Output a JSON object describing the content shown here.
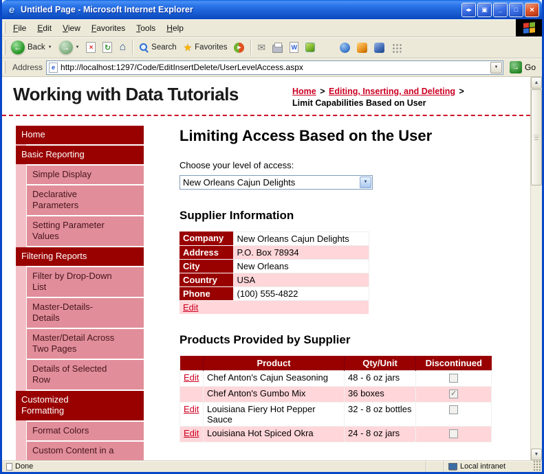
{
  "window": {
    "title": "Untitled Page - Microsoft Internet Explorer",
    "buttons": [
      {
        "name": "screen-toggle",
        "glyph": "◂▸"
      },
      {
        "name": "screen",
        "glyph": "▣"
      },
      {
        "name": "minimize",
        "glyph": "_"
      },
      {
        "name": "maximize",
        "glyph": "□"
      },
      {
        "name": "close",
        "glyph": "×"
      }
    ]
  },
  "menu": {
    "items": [
      "File",
      "Edit",
      "View",
      "Favorites",
      "Tools",
      "Help"
    ]
  },
  "toolbar": {
    "back_label": "Back",
    "search_label": "Search",
    "favorites_label": "Favorites"
  },
  "address": {
    "label": "Address",
    "url": "http://localhost:1297/Code/EditInsertDelete/UserLevelAccess.aspx",
    "go_label": "Go"
  },
  "status": {
    "left": "Done",
    "right": "Local intranet"
  },
  "icons": {
    "back_arrow": "←",
    "forward_arrow": "→",
    "stop": "×",
    "refresh": "↻",
    "home": "⌂",
    "star": "★",
    "media_play": "▶",
    "mail": "✉",
    "word_w": "W",
    "dropdown": "▼",
    "scroll_up": "▲",
    "scroll_down": "▼",
    "go_arrow": "→",
    "ie_e": "e"
  },
  "page": {
    "site_title": "Working with Data Tutorials",
    "breadcrumb": {
      "separator": ">",
      "links": [
        "Home",
        "Editing, Inserting, and Deleting"
      ],
      "current": "Limit Capabilities Based on User"
    },
    "sidebar": [
      {
        "label": "Home",
        "level": 0
      },
      {
        "label": "Basic Reporting",
        "level": 0
      },
      {
        "label": "Simple Display",
        "level": 1
      },
      {
        "label": "Declarative Parameters",
        "level": 1
      },
      {
        "label": "Setting Parameter Values",
        "level": 1
      },
      {
        "label": "Filtering Reports",
        "level": 0
      },
      {
        "label": "Filter by Drop-Down List",
        "level": 1
      },
      {
        "label": "Master-Details-Details",
        "level": 1
      },
      {
        "label": "Master/Detail Across Two Pages",
        "level": 1
      },
      {
        "label": "Details of Selected Row",
        "level": 1
      },
      {
        "label": "Customized Formatting",
        "level": 0
      },
      {
        "label": "Format Colors",
        "level": 1
      },
      {
        "label": "Custom Content in a",
        "level": 1
      }
    ],
    "main": {
      "title": "Limiting Access Based on the User",
      "access_label": "Choose your level of access:",
      "access_value": "New Orleans Cajun Delights",
      "supplier_heading": "Supplier Information",
      "supplier": {
        "edit_label": "Edit",
        "rows": [
          {
            "label": "Company",
            "value": "New Orleans Cajun Delights"
          },
          {
            "label": "Address",
            "value": "P.O. Box 78934"
          },
          {
            "label": "City",
            "value": "New Orleans"
          },
          {
            "label": "Country",
            "value": "USA"
          },
          {
            "label": "Phone",
            "value": "(100) 555-4822"
          }
        ]
      },
      "products_heading": "Products Provided by Supplier",
      "products": {
        "headers": [
          "",
          "Product",
          "Qty/Unit",
          "Discontinued"
        ],
        "rows": [
          {
            "edit": "Edit",
            "product": "Chef Anton's Cajun Seasoning",
            "qty": "48 - 6 oz jars",
            "discontinued": false
          },
          {
            "edit": "",
            "product": "Chef Anton's Gumbo Mix",
            "qty": "36 boxes",
            "discontinued": true
          },
          {
            "edit": "Edit",
            "product": "Louisiana Fiery Hot Pepper Sauce",
            "qty": "32 - 8 oz bottles",
            "discontinued": false
          },
          {
            "edit": "Edit",
            "product": "Louisiana Hot Spiced Okra",
            "qty": "24 - 8 oz jars",
            "discontinued": false
          }
        ]
      }
    }
  },
  "colors": {
    "dark_red": "#990000",
    "sidebar_pink": "#E18E9A",
    "stripe_pink": "#F3BFC7",
    "row_pink": "#FFD6D9",
    "link_red": "#CC0022",
    "titlebar_blue": "#1558CC",
    "chrome_beige": "#ECE9D8"
  }
}
